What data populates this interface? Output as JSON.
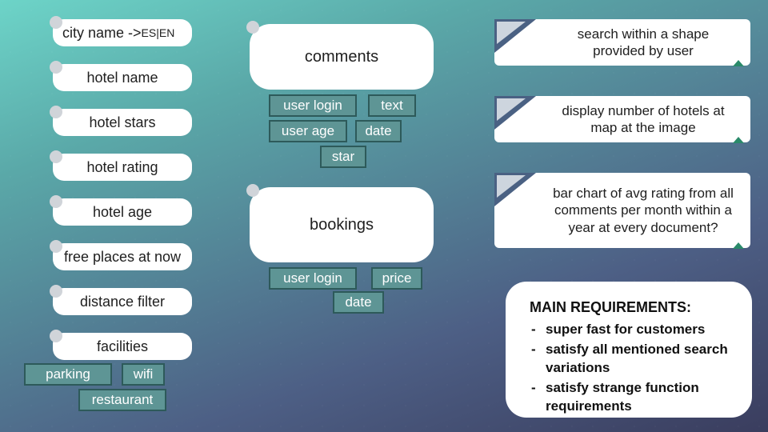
{
  "left": {
    "city": "city name -> ",
    "city_langs": "ES|EN",
    "hotel_name": "hotel name",
    "hotel_stars": "hotel stars",
    "hotel_rating": "hotel rating",
    "hotel_age": "hotel age",
    "free_places": "free places at now",
    "distance_filter": "distance filter",
    "facilities": "facilities",
    "facilities_items": {
      "parking": "parking",
      "wifi": "wifi",
      "restaurant": "restaurant"
    }
  },
  "comments": {
    "title": "comments",
    "fields": {
      "user_login": "user login",
      "text": "text",
      "user_age": "user age",
      "date": "date",
      "star": "star"
    }
  },
  "bookings": {
    "title": "bookings",
    "fields": {
      "user_login": "user login",
      "price": "price",
      "date": "date"
    }
  },
  "callouts": {
    "shape": "search within a shape provided by user",
    "map": "display number of hotels at map at the image",
    "chart": "bar chart of avg rating from all comments per month within a year at every document?"
  },
  "requirements": {
    "heading": "MAIN REQUIREMENTS:",
    "items": [
      "super fast for customers",
      "satisfy all mentioned search variations",
      "satisfy strange function requirements"
    ]
  }
}
